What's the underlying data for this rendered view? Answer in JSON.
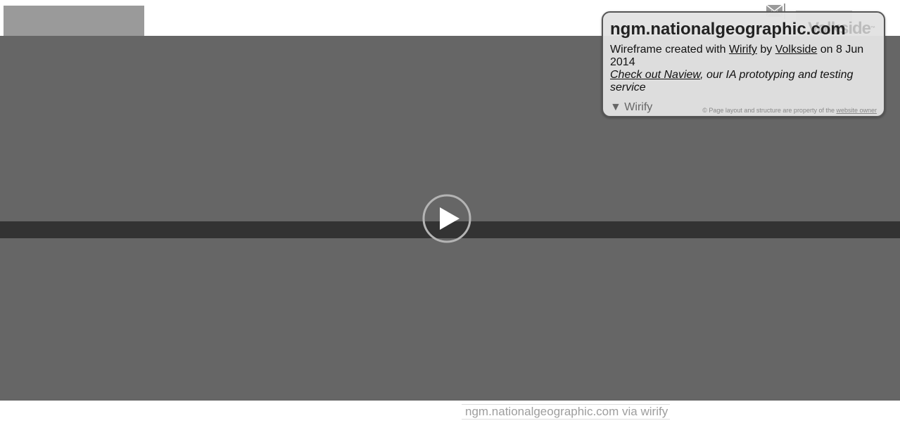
{
  "header": {
    "logo": "logo-placeholder",
    "mail_icon": "mail-icon"
  },
  "hero": {
    "play_icon": "play-icon"
  },
  "footer": {
    "link_text": "ngm.nationalgeographic.com via wirify"
  },
  "wirify_popup": {
    "watermark": "Volkside",
    "watermark_tm": "™",
    "title": "ngm.nationalgeographic.com",
    "line1_prefix": "Wireframe created with ",
    "wirify_link": "Wirify",
    "line1_by": " by ",
    "volkside_link": "Volkside",
    "line1_suffix": " on 8 Jun 2014",
    "naview_link": "Check out Naview",
    "line2_suffix": ", our IA prototyping and testing service",
    "toggle_label": "▼ Wirify",
    "copyright_symbol": "©",
    "copyright_text": " Page layout and structure are property of the ",
    "owner_link": "website owner"
  },
  "colors": {
    "hero": "#666666",
    "band": "#333333",
    "placeholder": "#9a9a9a",
    "popup_bg": "#e2e2e2"
  }
}
